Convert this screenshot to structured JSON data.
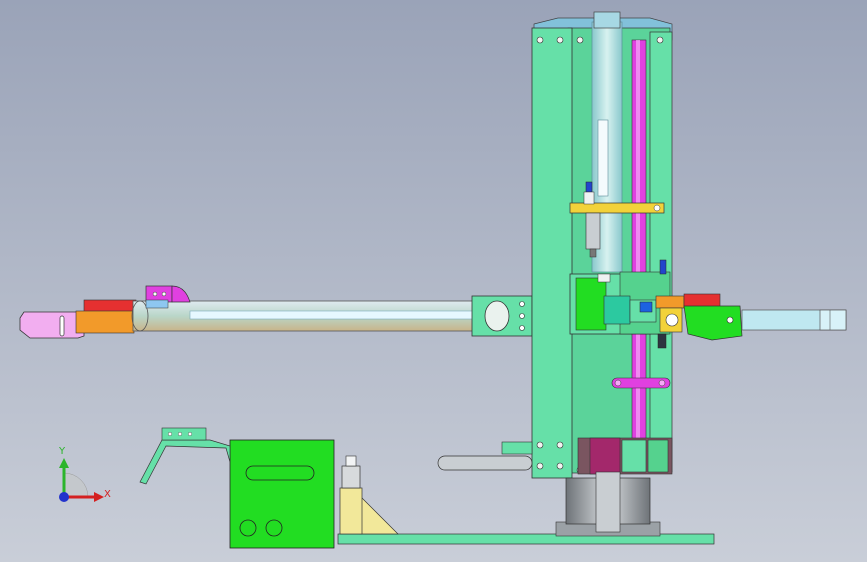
{
  "view": {
    "background_top": "#9aa3b8",
    "background_bottom": "#c9ced8"
  },
  "triad": {
    "y_label": "Y",
    "x_label": "X",
    "y_color": "#2bb52b",
    "x_color": "#d42020",
    "z_color": "#2233cc"
  },
  "colors": {
    "frame_green": "#66e0a8",
    "bright_green": "#22dd22",
    "magenta": "#e040e0",
    "yellow": "#f2d23a",
    "orange": "#f29a2a",
    "pink": "#f2aef0",
    "red": "#e53030",
    "light_cyan": "#bfe8f0",
    "steel_gray": "#a9aeb4",
    "cream": "#f2e89a",
    "blue": "#2244cc"
  }
}
